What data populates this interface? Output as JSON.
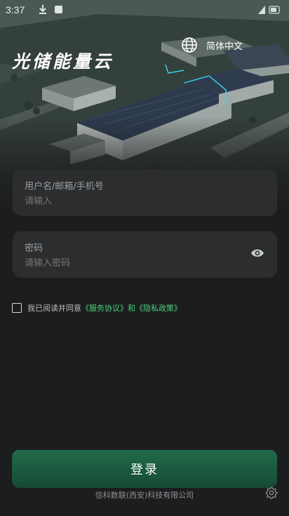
{
  "status_bar": {
    "time": "3:37"
  },
  "app": {
    "title": "光储能量云"
  },
  "language": {
    "label": "简体中文"
  },
  "username_field": {
    "label": "用户名/邮箱/手机号",
    "placeholder": "请输入"
  },
  "password_field": {
    "label": "密码",
    "placeholder": "请输入密码"
  },
  "agreement": {
    "prefix": "我已阅读并同意",
    "service_link": "《服务协议》",
    "conjunction": "和",
    "privacy_link": "《隐私政策》",
    "checked": false
  },
  "login_button": {
    "label": "登录"
  },
  "footer": {
    "company": "信科数联(西安)科技有限公司"
  },
  "colors": {
    "background": "#1c1d1f",
    "field_bg": "#2c2d2f",
    "accent": "#4ad07a",
    "button": "#1b5a3f"
  }
}
